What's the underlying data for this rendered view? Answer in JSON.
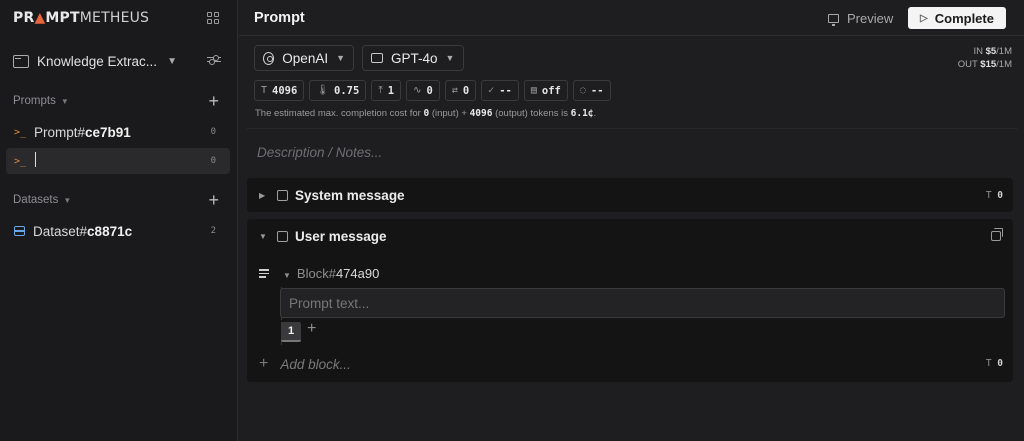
{
  "sidebar": {
    "logo": {
      "part1": "PR",
      "part2": "MPT",
      "part3": "METHEUS"
    },
    "project_name": "Knowledge Extrac...",
    "prompts_label": "Prompts",
    "prompts": [
      {
        "prefix": "Prompt#",
        "id": "ce7b91",
        "count": "0"
      },
      {
        "prefix": "",
        "id": "",
        "count": "0"
      }
    ],
    "datasets_label": "Datasets",
    "datasets": [
      {
        "prefix": "Dataset#",
        "id": "c8871c",
        "count": "2"
      }
    ]
  },
  "header": {
    "title": "Prompt",
    "preview_label": "Preview",
    "complete_label": "Complete"
  },
  "model": {
    "provider": "OpenAI",
    "name": "GPT-4o",
    "pricing_in_label": "IN",
    "pricing_in_value": "$5",
    "pricing_in_unit": "/1M",
    "pricing_out_label": "OUT",
    "pricing_out_value": "$15",
    "pricing_out_unit": "/1M"
  },
  "params": [
    {
      "icon": "T",
      "value": "4096",
      "name": "max-tokens"
    },
    {
      "icon": "🌡",
      "value": "0.75",
      "name": "temperature"
    },
    {
      "icon": "⤒",
      "value": "1",
      "name": "top-p"
    },
    {
      "icon": "∿",
      "value": "0",
      "name": "frequency-penalty"
    },
    {
      "icon": "⇄",
      "value": "0",
      "name": "presence-penalty"
    },
    {
      "icon": "✓",
      "value": "--",
      "name": "response-format"
    },
    {
      "icon": "▤",
      "value": "off",
      "name": "json-mode"
    },
    {
      "icon": "◌",
      "value": "--",
      "name": "seed"
    }
  ],
  "estimate": {
    "pre": "The estimated max. completion cost for",
    "input_tokens": "0",
    "mid1": "(input) +",
    "output_tokens": "4096",
    "mid2": "(output) tokens is",
    "cost": "6.1¢",
    "post": "."
  },
  "description_placeholder": "Description / Notes...",
  "system_message": {
    "title": "System message",
    "tokens": "0"
  },
  "user_message": {
    "title": "User message",
    "block_prefix": "Block#",
    "block_id": "474a90",
    "prompt_placeholder": "Prompt text...",
    "version": "1",
    "add_block_label": "Add block...",
    "tokens": "0"
  },
  "colors": {
    "accent": "#e8643c",
    "dataset": "#6aa7e6",
    "complete_bg": "#f4f4f4"
  }
}
